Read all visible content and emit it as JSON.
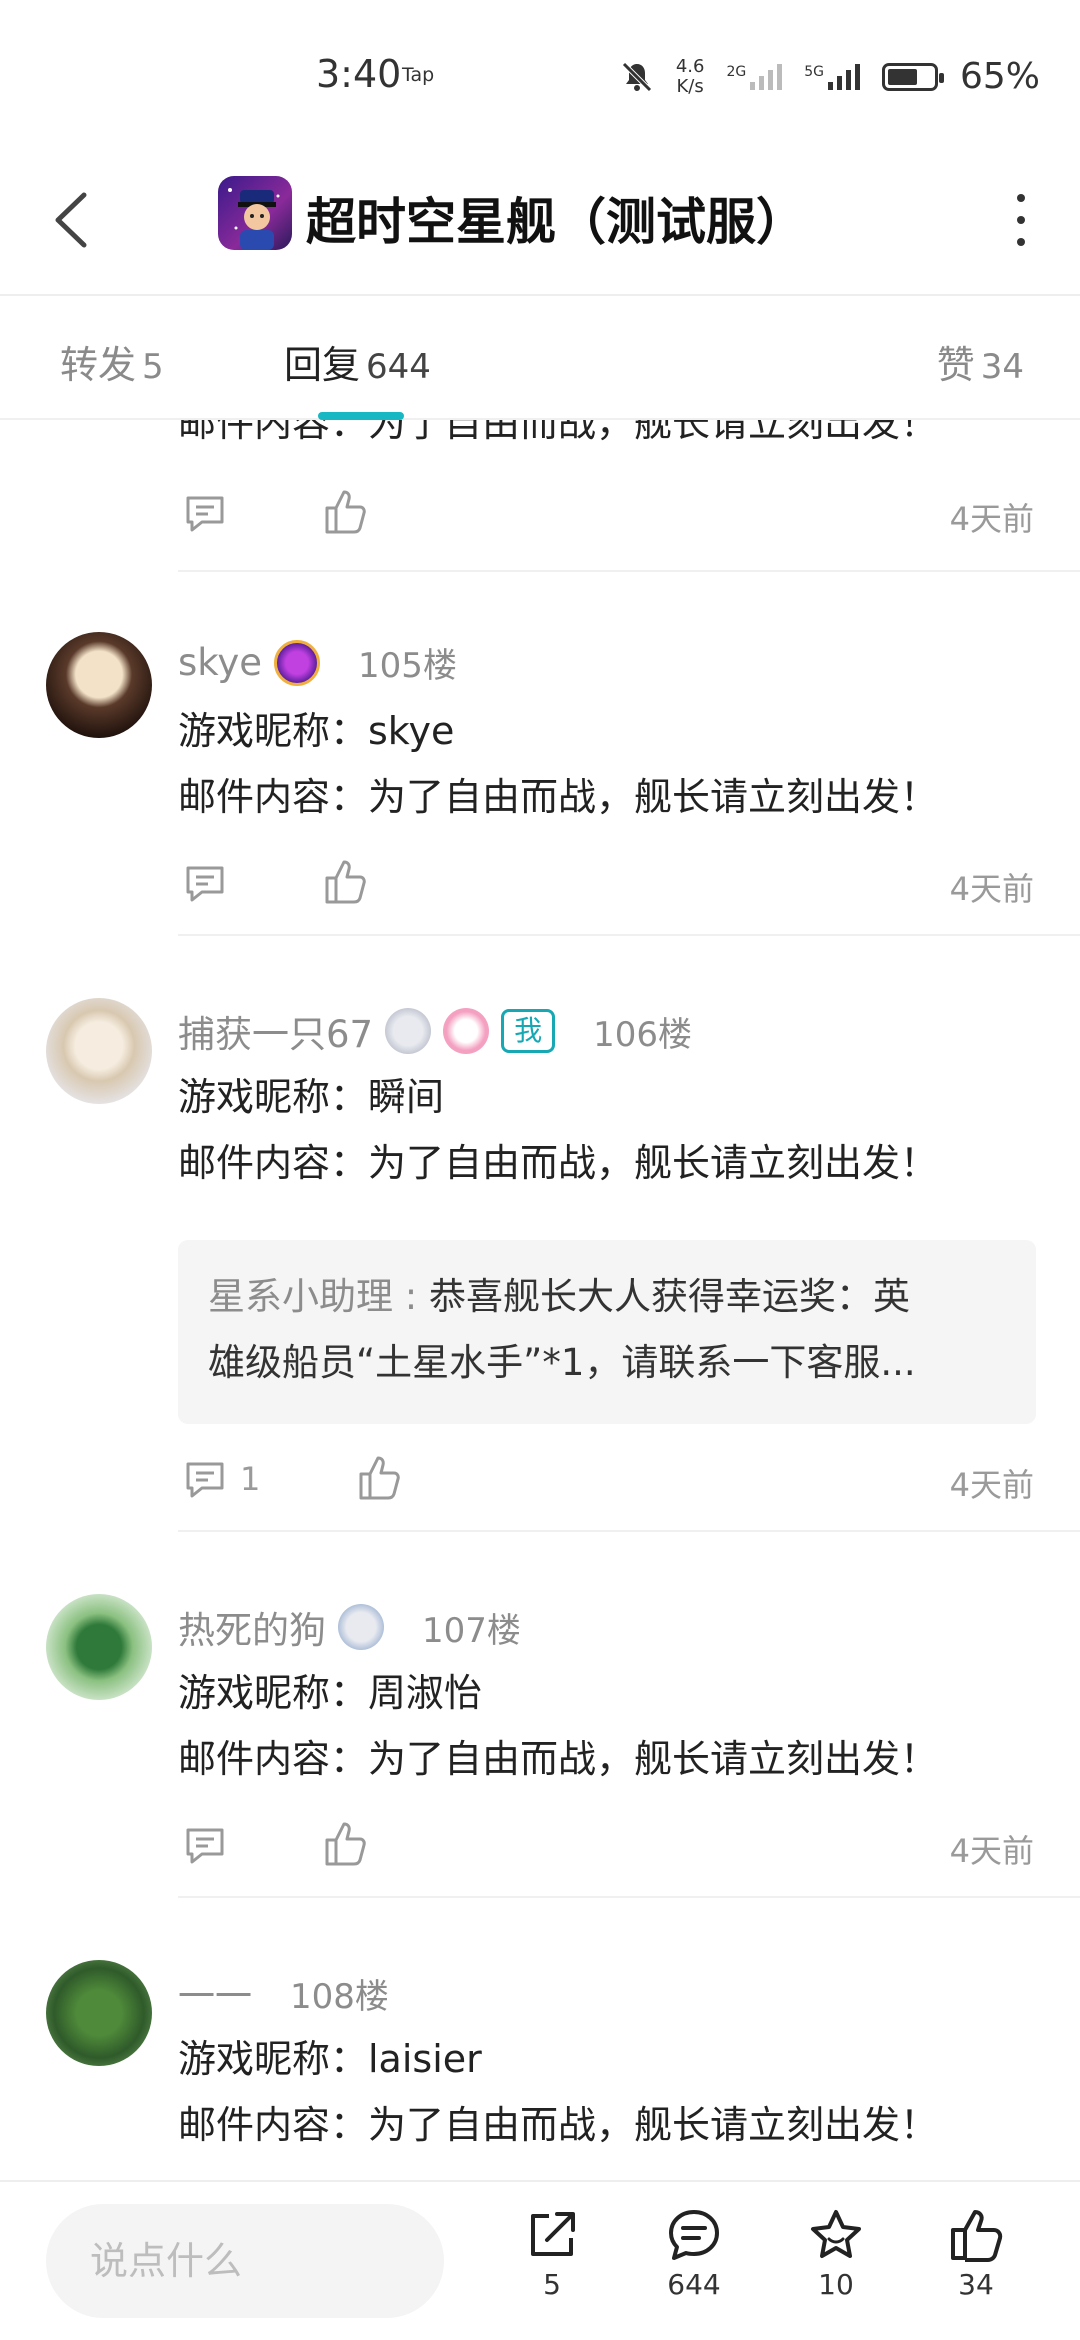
{
  "status_bar": {
    "time": "3:40",
    "tap": "Tap",
    "net_speed_value": "4.6",
    "net_speed_unit": "K/s",
    "sim1": "2G",
    "sim2": "5G",
    "battery_level": 0.65,
    "battery_text": "65%"
  },
  "header": {
    "title": "超时空星舰（测试服）"
  },
  "tabs": [
    {
      "label": "转发",
      "count": "5"
    },
    {
      "label": "回复",
      "count": "644"
    },
    {
      "label": "赞",
      "count": "34"
    }
  ],
  "replies": [
    {
      "mail_line": "邮件内容：为了自由而战，舰长请立刻出发！",
      "time": "4天前"
    },
    {
      "user": "skye",
      "floor": "105楼",
      "nickname_line": "游戏昵称：skye",
      "mail_line": "邮件内容：为了自由而战，舰长请立刻出发！",
      "time": "4天前"
    },
    {
      "user": "捕获一只67",
      "me_badge": "我",
      "floor": "106楼",
      "nickname_line": "游戏昵称：瞬间",
      "mail_line": "邮件内容：为了自由而战，舰长请立刻出发！",
      "sub_reply": {
        "author": "星系小助理 : ",
        "text_line1": "恭喜舰长大人获得幸运奖：英",
        "text_line2": "雄级船员“土星水手”*1，请联系一下客服..."
      },
      "comment_count": "1",
      "time": "4天前"
    },
    {
      "user": "热死的狗",
      "floor": "107楼",
      "nickname_line": "游戏昵称：周淑怡",
      "mail_line": "邮件内容：为了自由而战，舰长请立刻出发！",
      "time": "4天前"
    },
    {
      "user": "一一",
      "floor": "108楼",
      "nickname_line": "游戏昵称：laisier",
      "mail_line": "邮件内容：为了自由而战，舰长请立刻出发！"
    }
  ],
  "bottom_bar": {
    "input_placeholder": "说点什么",
    "share_count": "5",
    "comment_count": "644",
    "favorite_count": "10",
    "like_count": "34"
  },
  "colors": {
    "accent": "#17b8c4",
    "text_primary": "#222222",
    "text_secondary": "#8c8c8c"
  }
}
